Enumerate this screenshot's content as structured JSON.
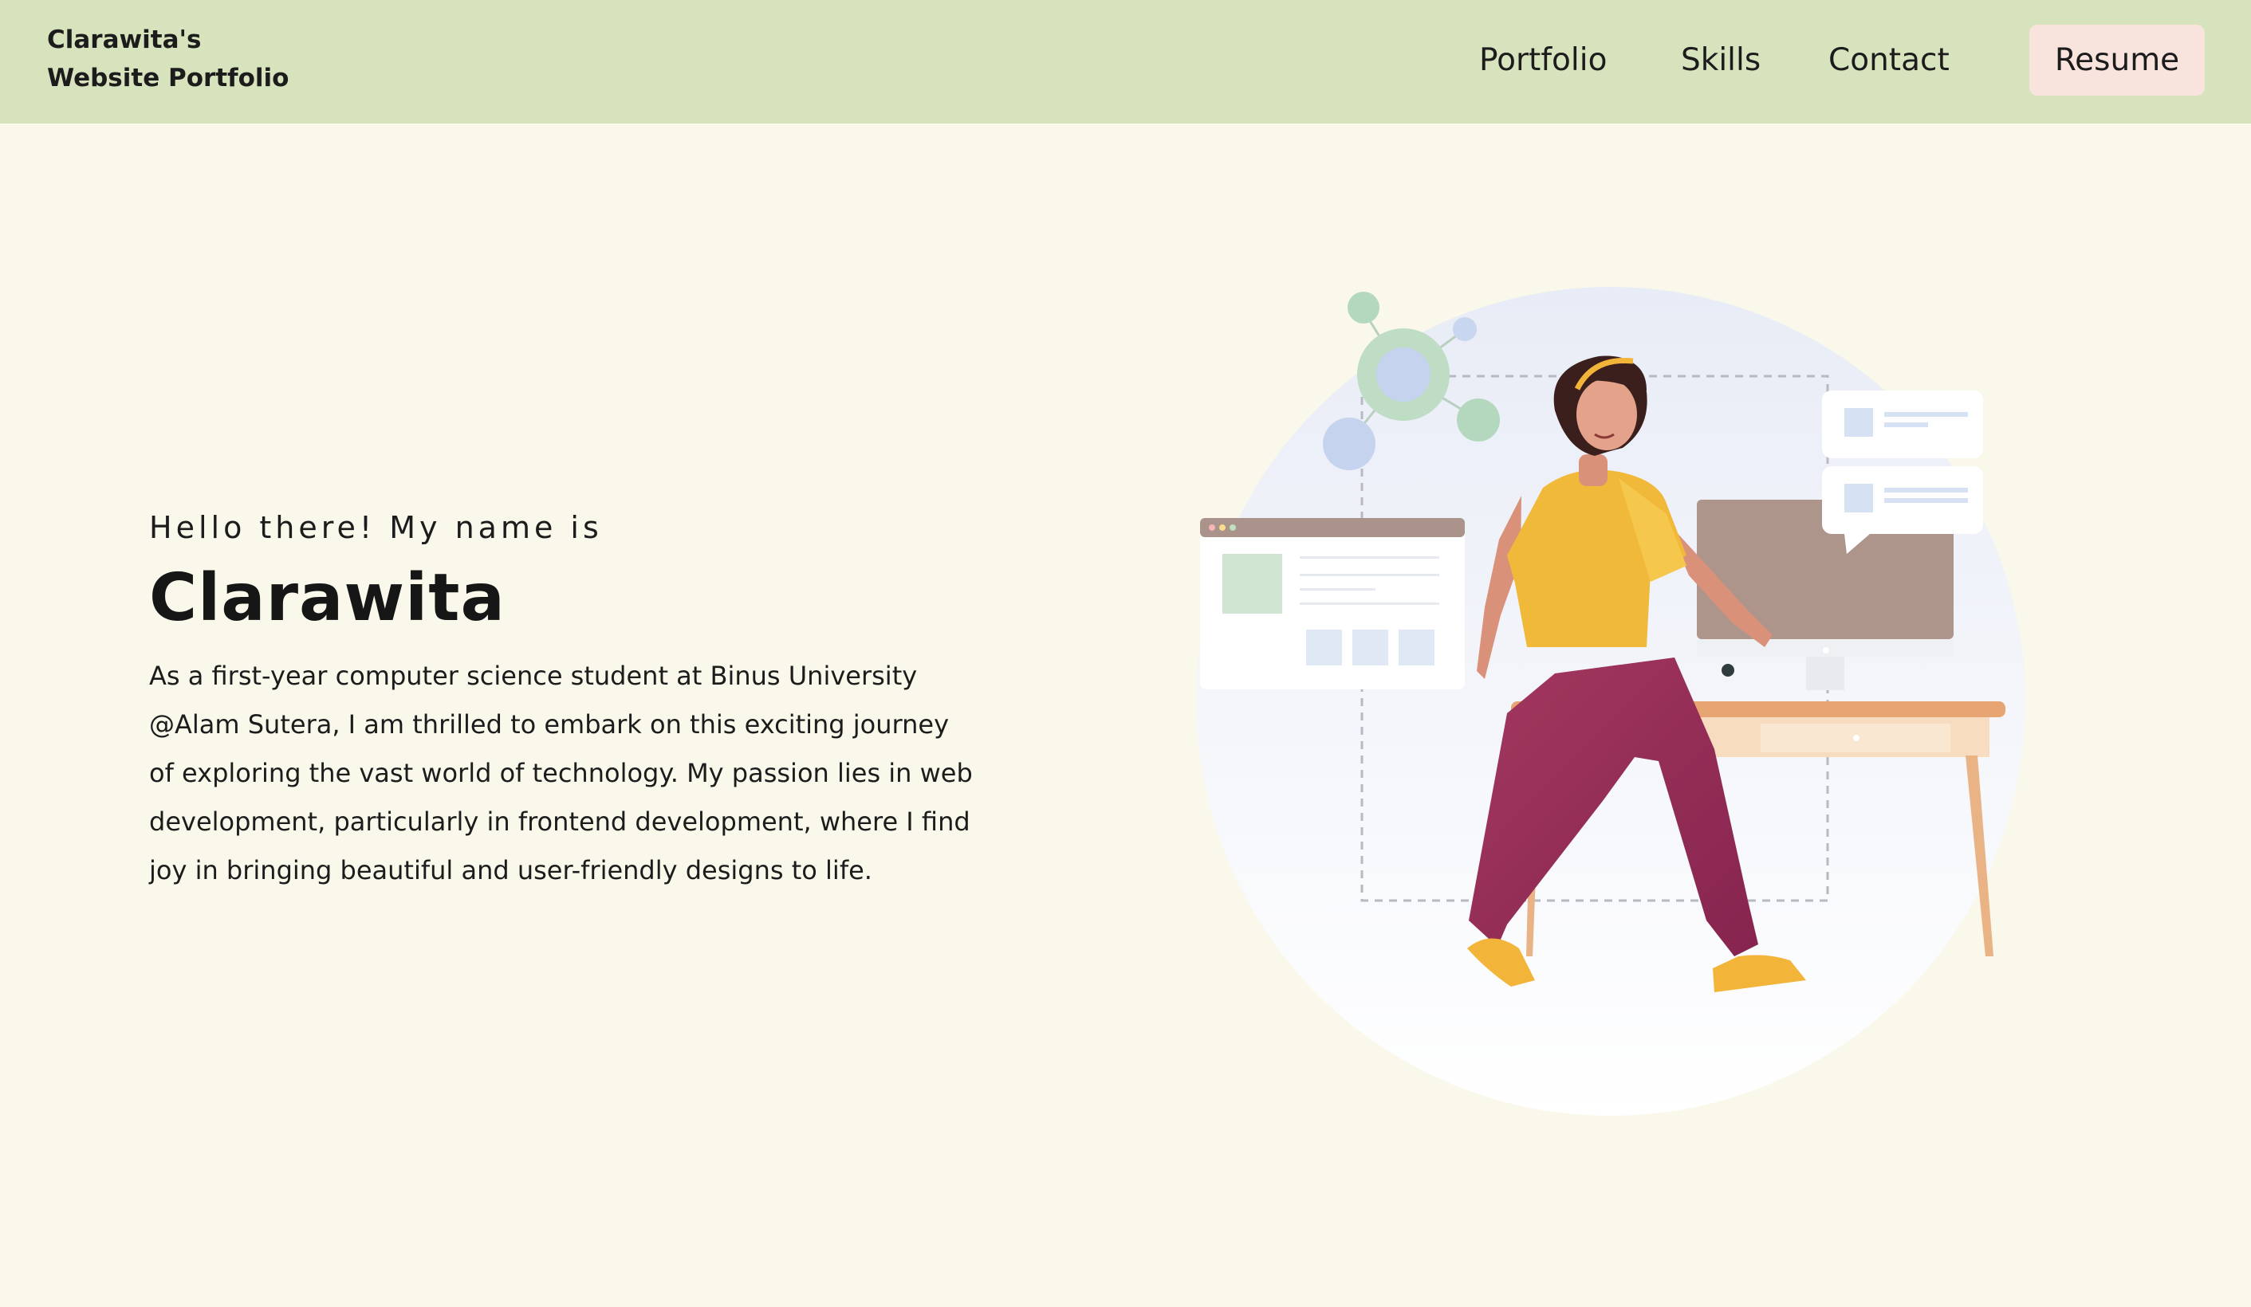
{
  "header": {
    "brand_line1": "Clarawita's",
    "brand_line2": "Website Portfolio",
    "nav": [
      {
        "label": "Portfolio"
      },
      {
        "label": "Skills"
      },
      {
        "label": "Contact"
      }
    ],
    "resume_label": "Resume"
  },
  "hero": {
    "greeting": "Hello there! My name is",
    "name": "Clarawita",
    "bio": "As a first-year computer science student at Binus University @Alam Sutera, I am thrilled to embark on this exciting journey of exploring the vast world of technology. My passion lies in web development, particularly in frontend development, where I find joy in bringing beautiful and user-friendly designs to life."
  },
  "colors": {
    "page_background": "#f9f8ea",
    "navbar_background": "#d7e3bd",
    "resume_button": "#f8e3dd"
  }
}
